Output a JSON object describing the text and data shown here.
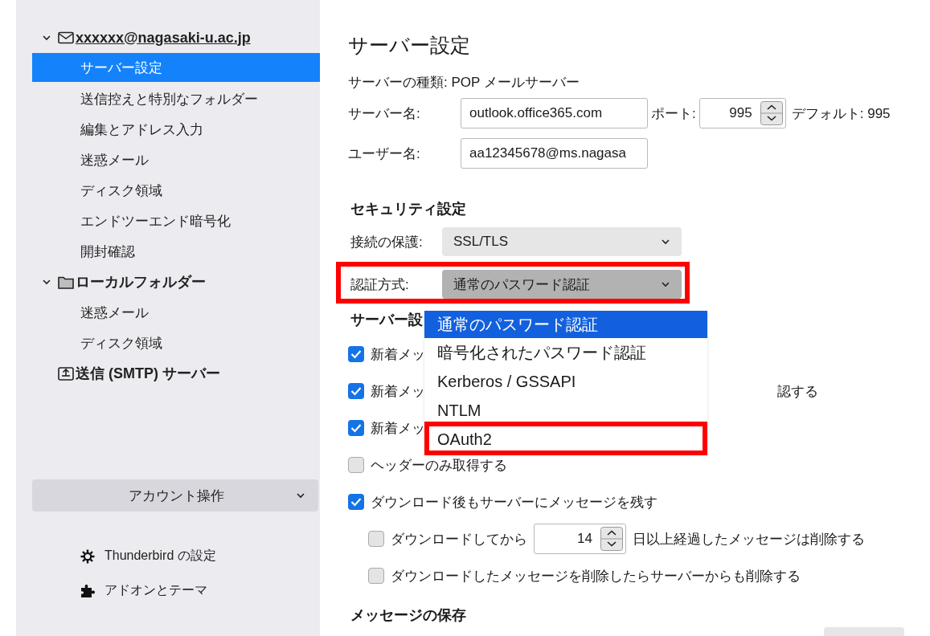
{
  "sidebar": {
    "tree": [
      {
        "kind": "account",
        "label": "xxxxxx@nagasaki-u.ac.jp",
        "expanded": true,
        "selected": false,
        "children": [
          {
            "label": "サーバー設定",
            "selected": true
          },
          {
            "label": "送信控えと特別なフォルダー",
            "selected": false
          },
          {
            "label": "編集とアドレス入力",
            "selected": false
          },
          {
            "label": "迷惑メール",
            "selected": false
          },
          {
            "label": "ディスク領域",
            "selected": false
          },
          {
            "label": "エンドツーエンド暗号化",
            "selected": false
          },
          {
            "label": "開封確認",
            "selected": false
          }
        ]
      },
      {
        "kind": "folder",
        "label": "ローカルフォルダー",
        "expanded": true,
        "selected": false,
        "children": [
          {
            "label": "迷惑メール",
            "selected": false
          },
          {
            "label": "ディスク領域",
            "selected": false
          }
        ]
      },
      {
        "kind": "outbox",
        "label": "送信 (SMTP) サーバー",
        "selected": false
      }
    ],
    "account_actions": "アカウント操作",
    "links": [
      {
        "kind": "settings",
        "label": "Thunderbird の設定"
      },
      {
        "kind": "addons",
        "label": "アドオンとテーマ"
      }
    ]
  },
  "content": {
    "title": "サーバー設定",
    "server_type": "サーバーの種類: POP メールサーバー",
    "server_name": {
      "label": "サーバー名:",
      "value": "outlook.office365.com"
    },
    "port": {
      "label": "ポート:",
      "value": "995",
      "default": "デフォルト: 995"
    },
    "user_name": {
      "label": "ユーザー名:",
      "value": "aa12345678@ms.nagasa"
    },
    "security_heading": "セキュリティ設定",
    "connection": {
      "label": "接続の保護:",
      "value": "SSL/TLS"
    },
    "auth": {
      "label": "認証方式:",
      "value": "通常のパスワード認証",
      "open": true,
      "highlighted": true
    },
    "auth_menu": [
      {
        "label": "通常のパスワード認証",
        "selected": true,
        "highlighted": false
      },
      {
        "label": "暗号化されたパスワード認証",
        "selected": false,
        "highlighted": false
      },
      {
        "label": "Kerberos / GSSAPI",
        "selected": false,
        "highlighted": false
      },
      {
        "label": "NTLM",
        "selected": false,
        "highlighted": false
      },
      {
        "label": "OAuth2",
        "selected": false,
        "highlighted": true
      }
    ],
    "server_heading": "サーバー設",
    "options": [
      {
        "kind": "checkbox",
        "checked": true,
        "label": "新着メッ"
      },
      {
        "kind": "checkbox",
        "checked": true,
        "label": "新着メッ",
        "tail": "認する"
      },
      {
        "kind": "checkbox",
        "checked": true,
        "label": "新着メッ"
      },
      {
        "kind": "checkbox",
        "checked": false,
        "label": "ヘッダーのみ取得する"
      },
      {
        "kind": "checkbox",
        "checked": true,
        "label": "ダウンロード後もサーバーにメッセージを残す",
        "children": [
          {
            "kind": "spinner",
            "checked": false,
            "label": "ダウンロードしてから",
            "value": "14",
            "suffix": "日以上経過したメッセージは削除する"
          },
          {
            "kind": "checkbox",
            "checked": false,
            "label": "ダウンロードしたメッセージを削除したらサーバーからも削除する"
          }
        ]
      }
    ],
    "storage_heading": "メッセージの保存"
  }
}
